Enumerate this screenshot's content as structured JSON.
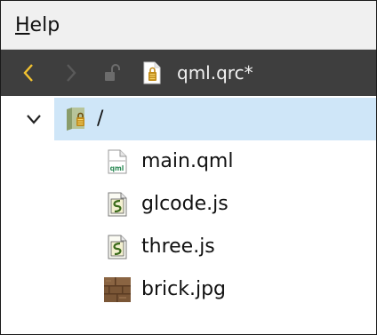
{
  "menu": {
    "help_mnemonic": "H",
    "help_rest": "elp"
  },
  "editor_toolbar": {
    "document_title": "qml.qrc*",
    "icons": {
      "back": "chevron-left-icon",
      "forward": "chevron-right-icon",
      "lock": "unlocked-icon",
      "file": "qrc-file-icon"
    },
    "colors": {
      "background": "#3e3e3e",
      "back_enabled": "#f2c230",
      "forward_disabled": "#5a5a5a"
    }
  },
  "tree": {
    "root": {
      "label": "/",
      "icon": "resource-folder-icon",
      "expanded": true
    },
    "items": [
      {
        "label": "main.qml",
        "icon": "qml-file-icon"
      },
      {
        "label": "glcode.js",
        "icon": "js-file-icon"
      },
      {
        "label": "three.js",
        "icon": "js-file-icon"
      },
      {
        "label": "brick.jpg",
        "icon": "image-thumbnail-icon"
      }
    ],
    "selection_color": "#cfe6f8"
  }
}
